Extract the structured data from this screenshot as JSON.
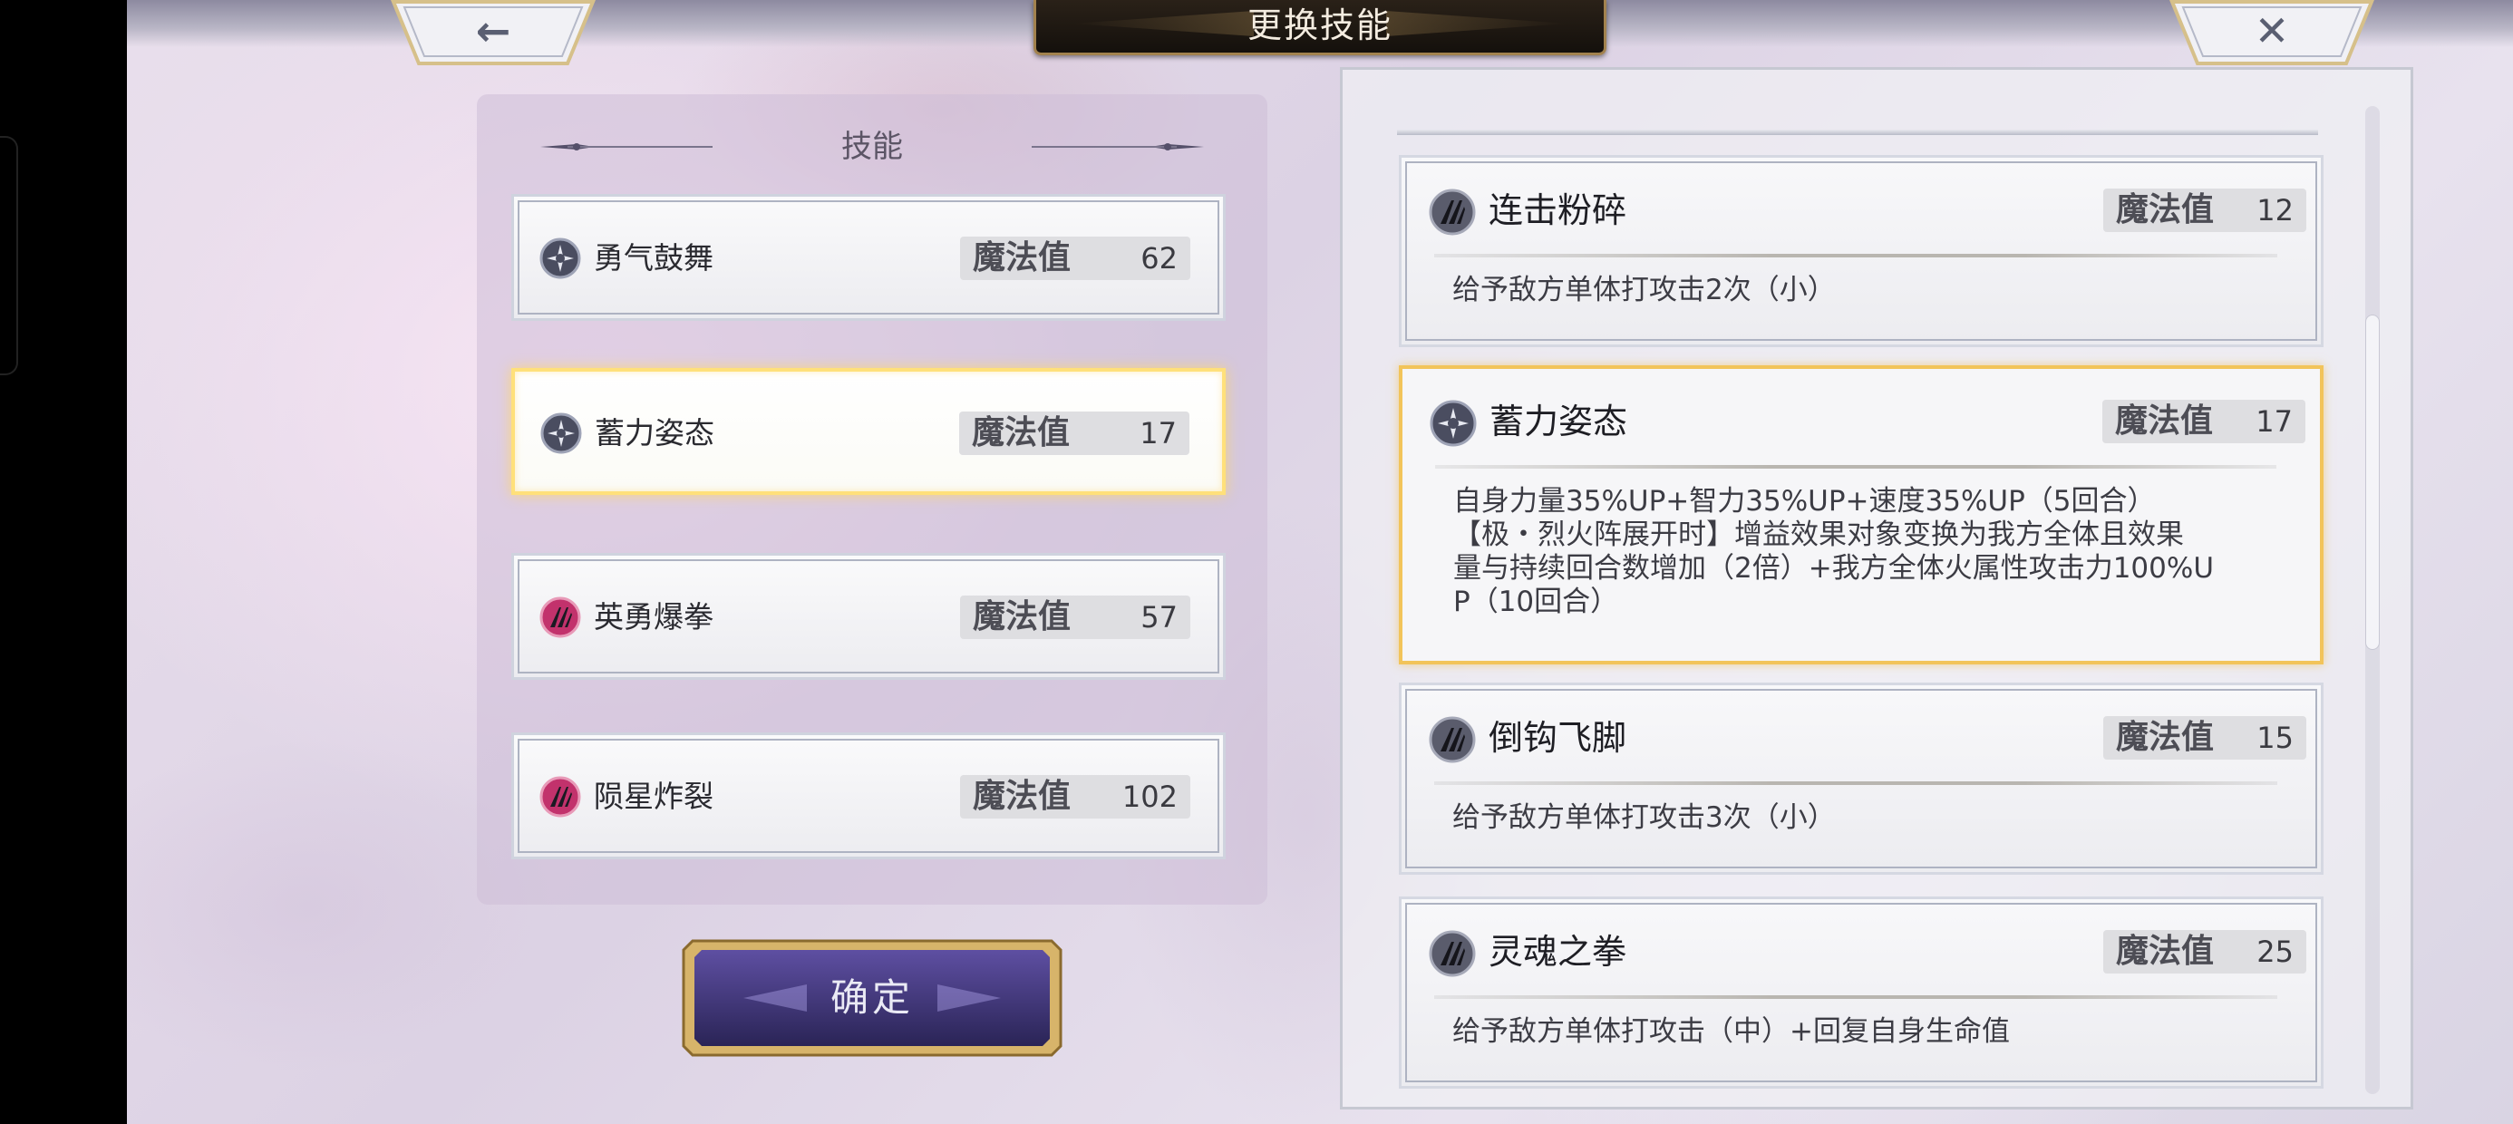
{
  "title": "更换技能",
  "nav": {
    "back_glyph": "←",
    "close_glyph": "✕"
  },
  "left_panel": {
    "title": "技能",
    "slots": [
      {
        "name": "勇气鼓舞",
        "mp_label": "魔法值",
        "mp": "62",
        "icon": "buff-icon",
        "selected": false
      },
      {
        "name": "蓄力姿态",
        "mp_label": "魔法值",
        "mp": "17",
        "icon": "buff-icon",
        "selected": true
      },
      {
        "name": "英勇爆拳",
        "mp_label": "魔法值",
        "mp": "57",
        "icon": "fire-attack-icon",
        "selected": false
      },
      {
        "name": "陨星炸裂",
        "mp_label": "魔法值",
        "mp": "102",
        "icon": "fire-attack-icon",
        "selected": false
      }
    ],
    "confirm_label": "确定"
  },
  "skill_list": [
    {
      "name": "连击粉碎",
      "mp_label": "魔法值",
      "mp": "12",
      "icon": "attack-icon",
      "desc": "给予敌方单体打攻击2次（小）"
    },
    {
      "name": "蓄力姿态",
      "mp_label": "魔法值",
      "mp": "17",
      "icon": "buff-icon",
      "selected": true,
      "desc": "自身力量35%UP+智力35%UP+速度35%UP（5回合）\n【极・烈火阵展开时】增益效果对象变换为我方全体且效果\n量与持续回合数增加（2倍）+我方全体火属性攻击力100%U\nP（10回合）"
    },
    {
      "name": "倒钩飞脚",
      "mp_label": "魔法值",
      "mp": "15",
      "icon": "attack-icon",
      "desc": "给予敌方单体打攻击3次（小）"
    },
    {
      "name": "灵魂之拳",
      "mp_label": "魔法值",
      "mp": "25",
      "icon": "attack-icon",
      "desc": "给予敌方单体打攻击（中）+回复自身生命值"
    }
  ],
  "colors": {
    "selected_border": "#ffe07a",
    "title_plate": "#1a140e",
    "title_border": "#a2824e",
    "confirm_bg": "#3a2f6a"
  }
}
